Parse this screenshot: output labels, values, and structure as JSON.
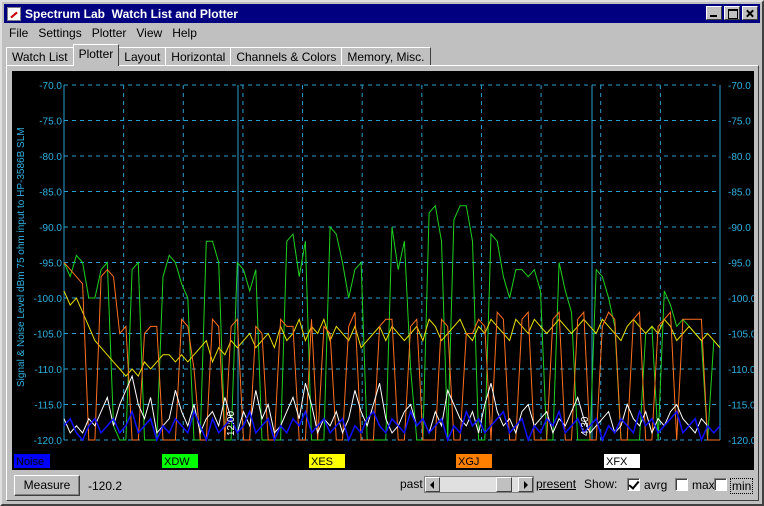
{
  "window": {
    "title": "Spectrum Lab  Watch List and Plotter",
    "menu": [
      "File",
      "Settings",
      "Plotter",
      "View",
      "Help"
    ],
    "tabs": [
      "Watch List",
      "Plotter",
      "Layout",
      "Horizontal",
      "Channels & Colors",
      "Memory, Misc."
    ],
    "active_tab": "Plotter"
  },
  "bottom": {
    "measure_label": "Measure",
    "measure_value": "-120.2",
    "past_label": "past",
    "present_label": "present",
    "show_label": "Show:",
    "scroll_position": 0.9,
    "checkboxes": [
      {
        "label": "avrg",
        "checked": true
      },
      {
        "label": "max",
        "checked": false
      },
      {
        "label": "min",
        "checked": false
      }
    ]
  },
  "chart_data": {
    "type": "line",
    "ylabel": "Signal & Noise Level dBm 75 ohm input to HP-3586B SLM",
    "ylim": [
      -120,
      -70
    ],
    "yticks": [
      "-70.0",
      "-75.0",
      "-80.0",
      "-85.0",
      "-90.0",
      "-95.0",
      "-100.0",
      "-105.0",
      "-110.0",
      "-115.0",
      "-120.0"
    ],
    "time_markers": [
      "12:00",
      "4:30"
    ],
    "grid": true,
    "legend": [
      {
        "name": "Noise",
        "color": "#0000ff"
      },
      {
        "name": "XDW",
        "color": "#00ff00"
      },
      {
        "name": "XES",
        "color": "#ffff00"
      },
      {
        "name": "XGJ",
        "color": "#ff8000"
      },
      {
        "name": "XFX",
        "color": "#ffffff"
      }
    ],
    "series": [
      {
        "name": "XDW",
        "color": "#20d020",
        "values": [
          -95,
          -97,
          -94,
          -95,
          -100,
          -100,
          -96,
          -95,
          -118,
          -120,
          -120,
          -96,
          -95,
          -120,
          -120,
          -120,
          -97,
          -94,
          -95,
          -98,
          -100,
          -120,
          -120,
          -92,
          -92,
          -95,
          -120,
          -120,
          -95,
          -96,
          -99,
          -96,
          -120,
          -120,
          -120,
          -120,
          -92,
          -91,
          -97,
          -92,
          -120,
          -120,
          -120,
          -90,
          -91,
          -95,
          -100,
          -96,
          -95,
          -120,
          -120,
          -120,
          -120,
          -90,
          -96,
          -92,
          -110,
          -120,
          -120,
          -88,
          -87,
          -92,
          -120,
          -89,
          -87,
          -87,
          -92,
          -120,
          -120,
          -91,
          -92,
          -97,
          -100,
          -96,
          -96,
          -97,
          -96,
          -99,
          -120,
          -120,
          -95,
          -99,
          -102,
          -120,
          -120,
          -120,
          -96,
          -97,
          -100,
          -104,
          -120,
          -120,
          -120,
          -120,
          -105,
          -104,
          -120,
          -99,
          -101,
          -104,
          -103,
          -104,
          -105,
          -106,
          -120,
          -106,
          -107
        ]
      },
      {
        "name": "XES",
        "color": "#e8e000",
        "values": [
          -99,
          -101,
          -100,
          -102,
          -104,
          -106,
          -107,
          -108,
          -109,
          -110,
          -111,
          -110,
          -111,
          -109,
          -110,
          -109,
          -108,
          -108,
          -109,
          -108,
          -109,
          -108,
          -107,
          -106,
          -109,
          -107,
          -108,
          -106,
          -107,
          -106,
          -105,
          -107,
          -106,
          -105,
          -107,
          -104,
          -106,
          -105,
          -103,
          -106,
          -104,
          -105,
          -103,
          -106,
          -104,
          -105,
          -106,
          -104,
          -107,
          -106,
          -105,
          -104,
          -106,
          -104,
          -105,
          -106,
          -105,
          -104,
          -106,
          -103,
          -104,
          -106,
          -105,
          -104,
          -103,
          -105,
          -106,
          -104,
          -105,
          -103,
          -104,
          -105,
          -106,
          -103,
          -104,
          -105,
          -103,
          -104,
          -105,
          -104,
          -103,
          -104,
          -105,
          -104,
          -103,
          -104,
          -105,
          -103,
          -104,
          -105,
          -106,
          -104,
          -103,
          -104,
          -105,
          -104,
          -105,
          -103,
          -104,
          -106,
          -105,
          -104,
          -105,
          -106,
          -105,
          -106,
          -107
        ]
      },
      {
        "name": "XGJ",
        "color": "#ff7020",
        "values": [
          -95,
          -96,
          -97,
          -98,
          -120,
          -120,
          -97,
          -96,
          -97,
          -105,
          -104,
          -120,
          -120,
          -105,
          -104,
          -104,
          -120,
          -120,
          -120,
          -103,
          -104,
          -110,
          -120,
          -120,
          -103,
          -104,
          -120,
          -104,
          -103,
          -120,
          -120,
          -104,
          -105,
          -120,
          -120,
          -103,
          -104,
          -104,
          -120,
          -120,
          -103,
          -120,
          -104,
          -105,
          -120,
          -120,
          -104,
          -102,
          -120,
          -120,
          -120,
          -104,
          -103,
          -103,
          -120,
          -120,
          -104,
          -103,
          -120,
          -120,
          -120,
          -103,
          -104,
          -120,
          -120,
          -105,
          -105,
          -103,
          -104,
          -120,
          -102,
          -103,
          -120,
          -120,
          -103,
          -102,
          -120,
          -120,
          -120,
          -103,
          -102,
          -120,
          -120,
          -103,
          -102,
          -120,
          -120,
          -104,
          -102,
          -103,
          -120,
          -120,
          -103,
          -102,
          -120,
          -120,
          -104,
          -103,
          -102,
          -120,
          -103,
          -103,
          -103,
          -103,
          -120,
          -120,
          -120
        ]
      },
      {
        "name": "XFX",
        "color": "#ffffff",
        "values": [
          -117,
          -119,
          -118,
          -119,
          -117,
          -118,
          -116,
          -114,
          -118,
          -115,
          -113,
          -111,
          -115,
          -117,
          -114,
          -119,
          -118,
          -117,
          -113,
          -116,
          -118,
          -115,
          -119,
          -117,
          -116,
          -118,
          -114,
          -117,
          -119,
          -116,
          -118,
          -113,
          -117,
          -115,
          -119,
          -118,
          -116,
          -114,
          -117,
          -112,
          -115,
          -119,
          -117,
          -118,
          -116,
          -119,
          -117,
          -113,
          -116,
          -118,
          -115,
          -112,
          -117,
          -119,
          -118,
          -116,
          -115,
          -118,
          -117,
          -119,
          -116,
          -118,
          -113,
          -115,
          -117,
          -118,
          -116,
          -119,
          -115,
          -112,
          -116,
          -118,
          -117,
          -119,
          -116,
          -115,
          -118,
          -117,
          -116,
          -119,
          -117,
          -118,
          -116,
          -114,
          -117,
          -119,
          -118,
          -117,
          -116,
          -119,
          -118,
          -115,
          -117,
          -118,
          -116,
          -119,
          -117,
          -118,
          -116,
          -115,
          -117,
          -118,
          -119,
          -117,
          -118,
          -119,
          -118
        ]
      },
      {
        "name": "Noise",
        "color": "#1010ff",
        "values": [
          -118,
          -117,
          -119,
          -120,
          -118,
          -117,
          -119,
          -118,
          -117,
          -119,
          -118,
          -116,
          -119,
          -118,
          -117,
          -120,
          -118,
          -119,
          -117,
          -118,
          -119,
          -116,
          -118,
          -120,
          -117,
          -119,
          -118,
          -117,
          -119,
          -118,
          -116,
          -119,
          -118,
          -117,
          -120,
          -118,
          -119,
          -117,
          -118,
          -116,
          -119,
          -118,
          -117,
          -119,
          -118,
          -117,
          -120,
          -118,
          -119,
          -117,
          -116,
          -118,
          -119,
          -117,
          -118,
          -119,
          -116,
          -118,
          -117,
          -119,
          -118,
          -117,
          -120,
          -118,
          -119,
          -116,
          -118,
          -117,
          -119,
          -118,
          -117,
          -116,
          -119,
          -118,
          -117,
          -120,
          -118,
          -119,
          -117,
          -118,
          -116,
          -119,
          -118,
          -117,
          -119,
          -118,
          -117,
          -120,
          -118,
          -119,
          -117,
          -118,
          -119,
          -116,
          -118,
          -117,
          -119,
          -118,
          -117,
          -116,
          -119,
          -118,
          -117,
          -120,
          -118,
          -119,
          -118
        ]
      }
    ]
  }
}
